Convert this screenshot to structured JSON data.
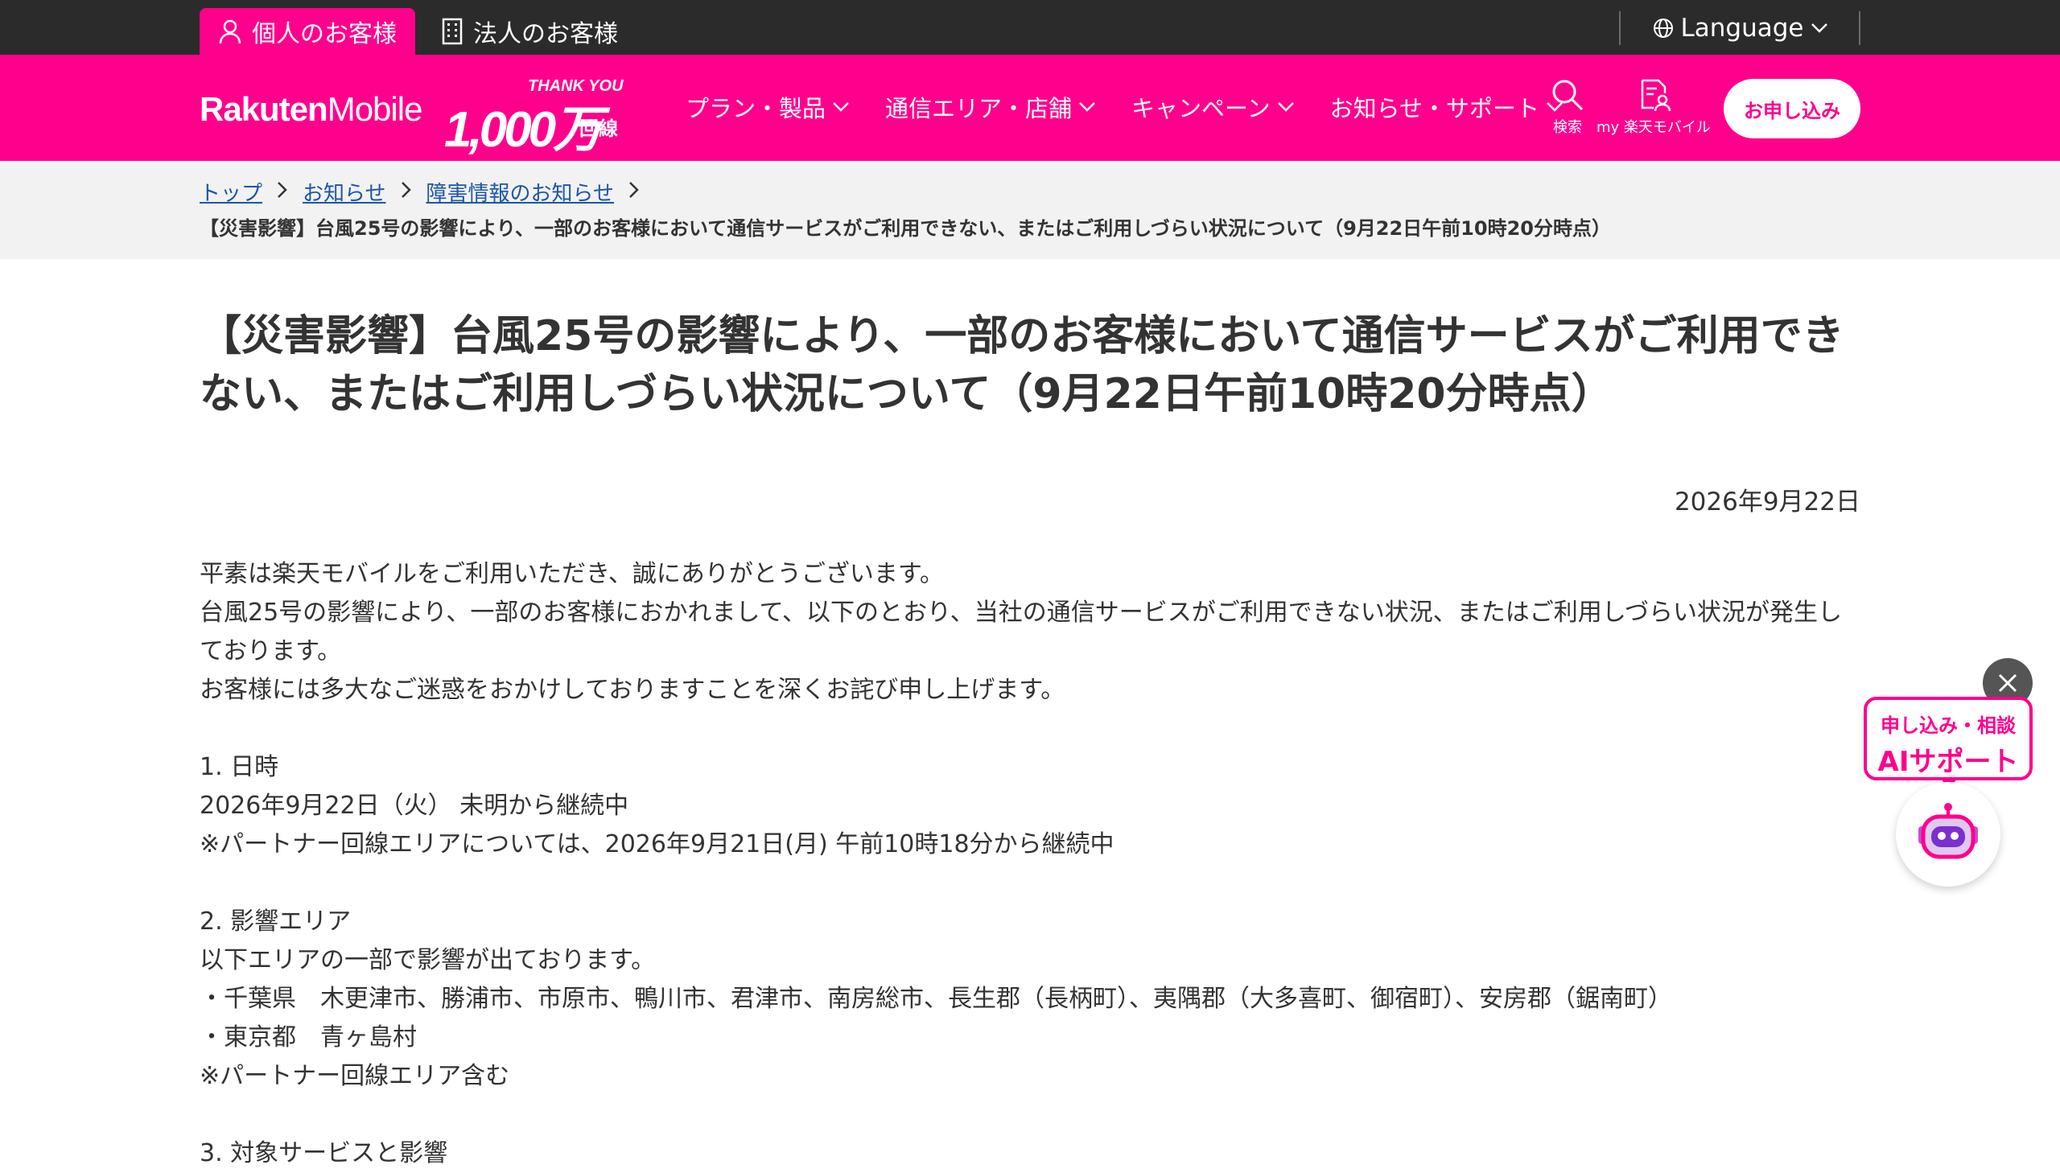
{
  "topbar": {
    "personal_label": "個人のお客様",
    "business_label": "法人のお客様",
    "language_label": "Language"
  },
  "header": {
    "logo_brand": "Rakuten",
    "logo_product": "Mobile",
    "campaign_thanks": "THANK YOU",
    "campaign_number": "1,000万",
    "campaign_unit": "回線",
    "nav": [
      {
        "label": "プラン・製品"
      },
      {
        "label": "通信エリア・店舗"
      },
      {
        "label": "キャンペーン"
      },
      {
        "label": "お知らせ・サポート"
      }
    ],
    "search_label": "検索",
    "my_label": "my 楽天モバイル",
    "apply_label": "お申し込み"
  },
  "breadcrumb": {
    "items": [
      {
        "label": "トップ"
      },
      {
        "label": "お知らせ"
      },
      {
        "label": "障害情報のお知らせ"
      }
    ],
    "current": "【災害影響】台風25号の影響により、一部のお客様において通信サービスがご利用できない、またはご利用しづらい状況について（9月22日午前10時20分時点）"
  },
  "article": {
    "title": "【災害影響】台風25号の影響により、一部のお客様において通信サービスがご利用できない、またはご利用しづらい状況について（9月22日午前10時20分時点）",
    "date": "2026年9月22日",
    "intro": [
      "平素は楽天モバイルをご利用いただき、誠にありがとうございます。",
      "台風25号の影響により、一部のお客様におかれまして、以下のとおり、当社の通信サービスがご利用できない状況、またはご利用しづらい状況が発生しております。",
      "お客様には多大なご迷惑をおかけしておりますことを深くお詫び申し上げます。"
    ],
    "section1": {
      "heading": "1. 日時",
      "lines": [
        "2026年9月22日（火） 未明から継続中",
        "※パートナー回線エリアについては、2026年9月21日(月) 午前10時18分から継続中"
      ]
    },
    "section2": {
      "heading": "2. 影響エリア",
      "lines": [
        "以下エリアの一部で影響が出ております。",
        "・千葉県　木更津市、勝浦市、市原市、鴨川市、君津市、南房総市、長生郡（長柄町）、夷隅郡（大多喜町、御宿町）、安房郡（鋸南町）",
        "・東京都　青ヶ島村",
        "※パートナー回線エリア含む"
      ]
    },
    "section3": {
      "heading": "3. 対象サービスと影響"
    }
  },
  "ai_widget": {
    "line1": "申し込み・相談",
    "line2": "AIサポート"
  },
  "colors": {
    "brand": "#ff008c",
    "topbar": "#2b2b2b",
    "link": "#1d56a5"
  },
  "icons": [
    "person-icon",
    "building-icon",
    "globe-icon",
    "chevron-down-icon",
    "search-icon",
    "document-user-icon",
    "chevron-right-icon",
    "close-icon",
    "robot-icon"
  ]
}
